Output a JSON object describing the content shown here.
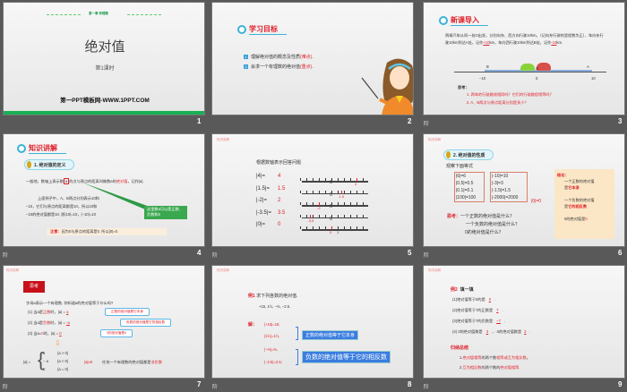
{
  "slides": [
    {
      "number": "1",
      "chapter": "第一章 有理数",
      "title": "绝对值",
      "subtitle": "第1课时",
      "footer": "第一PPT模板网-WWW.1PPT.COM",
      "accent": "#1aaf54"
    },
    {
      "number": "2",
      "header": "学习目标",
      "items": [
        {
          "n": "1",
          "text": "理解绝对值的概念及性质",
          "note": "(难点)",
          "end": "."
        },
        {
          "n": "2",
          "text": "会求一个有理数的绝对值",
          "note": "(重点)",
          "end": "."
        }
      ]
    },
    {
      "number": "3",
      "anim": "阶",
      "header": "新课导入",
      "para1": "两辆汽车从同一处O出发，分别向东、西方向行驶10km。（记向东行驶的里程数为正），车向东行驶10km到达A处，记作",
      "ans1": "+10",
      "para2": "km，车向西行驶10km到达B处，记作",
      "ans2": "-10",
      "para3": "km.",
      "labels": {
        "B": "B",
        "A": "A",
        "O": "O",
        "m10": "−10",
        "zero": "0",
        "p10": "10"
      },
      "think": "思考：",
      "q1": "1. 两车的行驶路线相同吗？它们的行驶路程相等吗？",
      "q2": "2. A、B两点与原点距离分别是多少？"
    },
    {
      "number": "4",
      "anim": "阶",
      "header": "知识讲解",
      "pill": "1. 绝对值的定义",
      "def_a": "一般地，数轴上表示数",
      "def_box": "a",
      "def_b": "的点与原点的距离叫做数a的",
      "def_red": "绝对值",
      "def_c": "，记作|a|.",
      "ex": [
        "上面例子中，A，B两点分别表示10和",
        "−10，它们与原点的距离都是10，所以10和",
        "−10的绝对值都是10. 即|10|=10，|−10|=10"
      ],
      "callout": "这里数a可以是正数、负数和0",
      "note_label": "注意：",
      "note": "因为0与原点的距离是0. 所以|0|=0."
    },
    {
      "number": "5",
      "anim": "阶",
      "tag": "知识讲解",
      "title": "根据数轴表示回答问题",
      "rows": [
        {
          "q": "|4|=",
          "a": "4",
          "mark": "4"
        },
        {
          "q": "|1.5|=",
          "a": "1.5",
          "mark": "1.5"
        },
        {
          "q": "|-2|=",
          "a": "2",
          "mark": "-2"
        },
        {
          "q": "|-3.5|=",
          "a": "3.5",
          "mark": "-3.5"
        },
        {
          "q": "|0|=",
          "a": "0",
          "mark": "0"
        }
      ],
      "zero": "0",
      "one": "1"
    },
    {
      "number": "6",
      "anim": "阶",
      "tag": "知识讲解",
      "pill": "2. 绝对值的性质",
      "observe": "观察下面等式",
      "col1": [
        "|6|=6",
        "|0.5|=0.5",
        "|0.1|=0.1",
        "|100|=100"
      ],
      "col2": [
        "|-10|=10",
        "|-3|=3",
        "|-1.5|=1.5",
        "|-2000|=2000"
      ],
      "zero_eq": "|0|=0",
      "think_label": "思考：",
      "think": [
        "一个正数的绝对值是什么？",
        "一个负数的绝对值是什么？",
        "0的绝对值是什么？"
      ],
      "conc_label": "结论：",
      "conc1": "一个正数的绝对值",
      "conc1b": "是",
      "conc1r": "它本身",
      "conc2": "一个负数的绝对值",
      "conc2b": "是",
      "conc2r": "它的相反数",
      "conc3": "0的绝对值是",
      "conc3r": "0"
    },
    {
      "number": "7",
      "anim": "阶",
      "tag": "知识讲解",
      "badge": "思考",
      "q": "字母a表示一个有理数, 你知道a的绝对值等于什么吗?",
      "lines": [
        {
          "a": "(1) 当a是",
          "r": "正数",
          "b": "时，|a| =",
          "ans": "a",
          "tip": "正数的绝对值是它本身"
        },
        {
          "a": "(2) 当a是",
          "r": "负数",
          "b": "时，|a| =",
          "ans": "-a",
          "tip": "负数的绝对值是它的相反数"
        },
        {
          "a": "(3) 当a=",
          "r": "0",
          "b": "时，|a| =",
          "ans": "0",
          "tip": "0的绝对值是0"
        }
      ],
      "piece": [
        "|a| =",
        "a",
        "(a > 0)",
        "− a",
        "(a < 0)",
        "0",
        "(a = 0)"
      ],
      "geq": "|a|≥0",
      "concl": "任何一个有理数的绝对值都是",
      "concl_r": "非负数"
    },
    {
      "number": "8",
      "anim": "阶",
      "tag": "知识讲解",
      "ex_label": "例1",
      "ex": "求下列各数的绝对值.",
      "nums": "+15, 1½, −⅔, −2.5.",
      "sol": "解：",
      "answers": [
        "|+15|=15;",
        "|1½|=1½,",
        "|−⅔|=⅔,",
        "|−2.5|=2.5;"
      ],
      "box1": "正数的绝对值等于它本身",
      "box2": "负数的绝对值等于它的相反数"
    },
    {
      "number": "9",
      "anim": "阶",
      "tag": "知识讲解",
      "ex_label": "例2",
      "ex": "填一填",
      "fills": [
        {
          "t": "(1)绝对值等于0的是",
          "a": "0",
          "e": "."
        },
        {
          "t": "(2)绝对值等于7的正数是",
          "a": "7",
          "e": "."
        },
        {
          "t": "(3)绝对值等于7的负数是",
          "a": "−7",
          "e": "."
        },
        {
          "t": "(4) 3的绝对值数是",
          "a": "3",
          "e": "，-3的绝对值数是",
          "a2": "3",
          "e2": "."
        }
      ],
      "sum_label": "归纳总结",
      "s1": [
        "1.",
        "绝对值相等",
        "的两个数",
        "相等或互为相反数",
        "。"
      ],
      "s2": [
        "2.",
        "互为相反数",
        "的两个数的",
        "绝对值相等",
        "."
      ]
    }
  ]
}
